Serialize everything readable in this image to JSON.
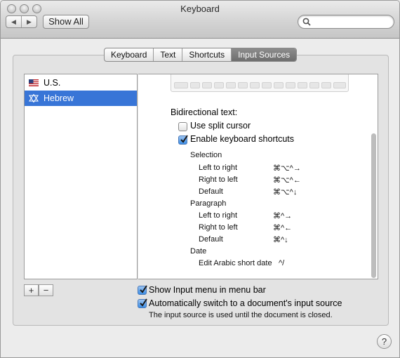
{
  "window": {
    "title": "Keyboard"
  },
  "toolbar": {
    "show_all_label": "Show All",
    "search_placeholder": "",
    "back_glyph": "◀",
    "forward_glyph": "▶"
  },
  "tabs": [
    {
      "label": "Keyboard",
      "active": false
    },
    {
      "label": "Text",
      "active": false
    },
    {
      "label": "Shortcuts",
      "active": false
    },
    {
      "label": "Input Sources",
      "active": true
    }
  ],
  "sources": [
    {
      "label": "U.S.",
      "icon": "us-flag-icon",
      "selected": false
    },
    {
      "label": "Hebrew",
      "icon": "star-of-david-icon",
      "selected": true
    }
  ],
  "bidi": {
    "heading": "Bidirectional text:",
    "use_split_cursor": {
      "label": "Use split cursor",
      "checked": false
    },
    "enable_shortcuts": {
      "label": "Enable keyboard shortcuts",
      "checked": true
    },
    "groups": [
      {
        "title": "Selection",
        "rows": [
          {
            "label": "Left to right",
            "keys": "⌘⌥^→"
          },
          {
            "label": "Right to left",
            "keys": "⌘⌥^←"
          },
          {
            "label": "Default",
            "keys": "⌘⌥^↓"
          }
        ]
      },
      {
        "title": "Paragraph",
        "rows": [
          {
            "label": "Left to right",
            "keys": "⌘^→"
          },
          {
            "label": "Right to left",
            "keys": "⌘^←"
          },
          {
            "label": "Default",
            "keys": "⌘^↓"
          }
        ]
      },
      {
        "title": "Date",
        "rows": [
          {
            "label": "Edit Arabic short date",
            "keys": "^/"
          }
        ]
      }
    ]
  },
  "list_controls": {
    "add": "+",
    "remove": "−"
  },
  "options": {
    "show_input_menu": {
      "label": "Show Input menu in menu bar",
      "checked": true
    },
    "auto_switch": {
      "label": "Automatically switch to a document's input source",
      "checked": true
    },
    "note": "The input source is used until the document is closed."
  },
  "help": "?",
  "colors": {
    "selection": "#3875d7",
    "checkbox_checked": "#3d8fe7",
    "active_tab": "#7a7a7a"
  }
}
